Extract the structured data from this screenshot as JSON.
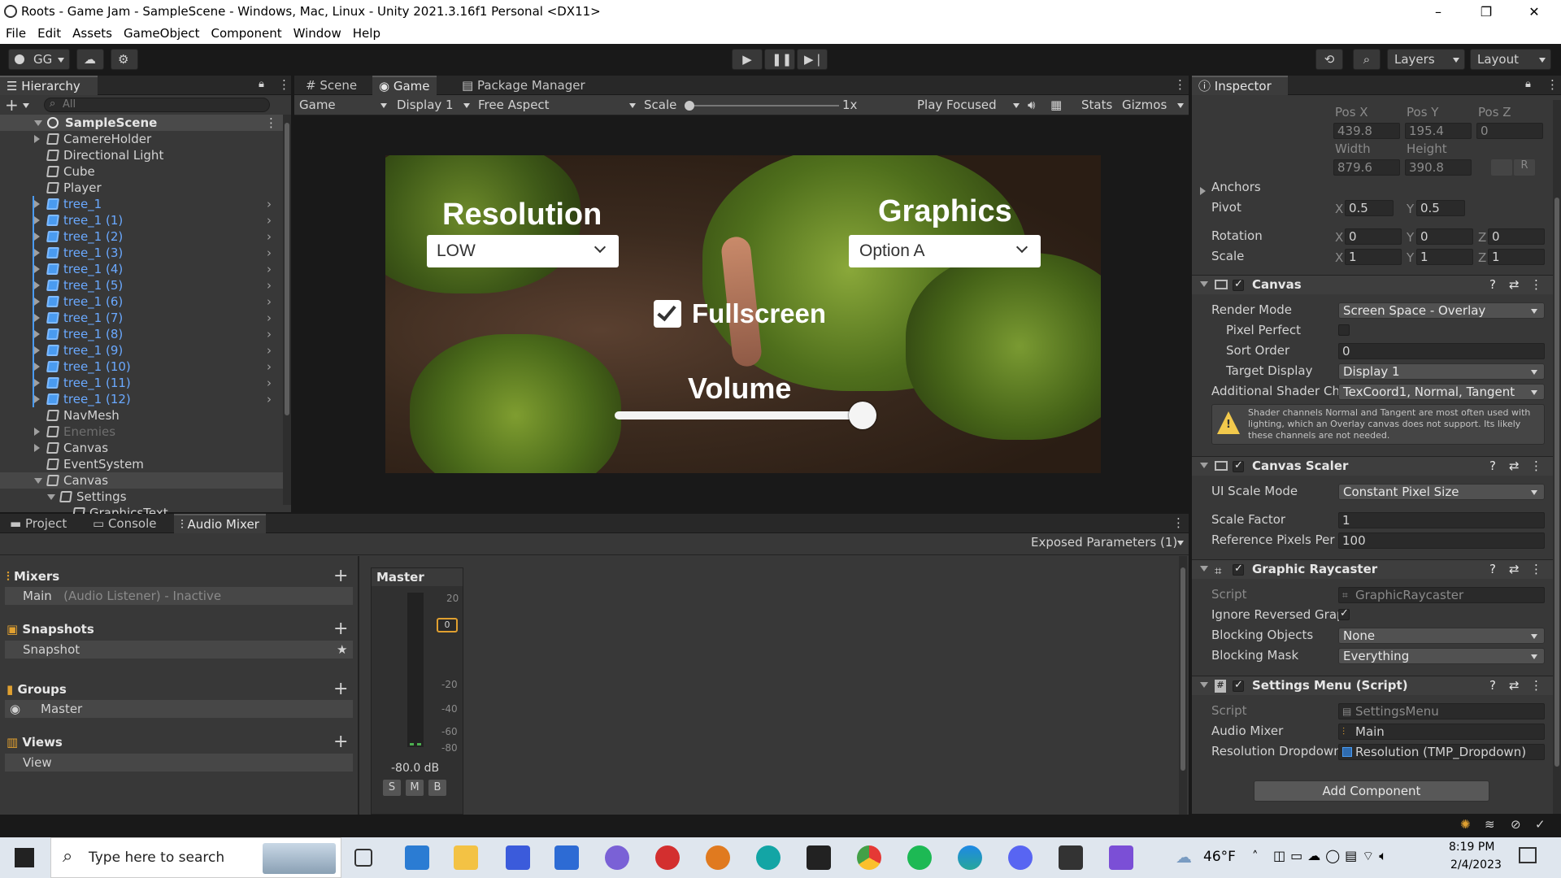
{
  "window": {
    "title": "Roots - Game Jam - SampleScene - Windows, Mac, Linux - Unity 2021.3.16f1 Personal <DX11>"
  },
  "menu": [
    "File",
    "Edit",
    "Assets",
    "GameObject",
    "Component",
    "Window",
    "Help"
  ],
  "toolbar": {
    "account": "GG",
    "layers": "Layers",
    "layout": "Layout"
  },
  "hierarchy": {
    "tab": "Hierarchy",
    "search_placeholder": "All",
    "scene": "SampleScene",
    "items": [
      "CamereHolder",
      "Directional Light",
      "Cube",
      "Player",
      "tree_1",
      "tree_1 (1)",
      "tree_1 (2)",
      "tree_1 (3)",
      "tree_1 (4)",
      "tree_1 (5)",
      "tree_1 (6)",
      "tree_1 (7)",
      "tree_1 (8)",
      "tree_1 (9)",
      "tree_1 (10)",
      "tree_1 (11)",
      "tree_1 (12)",
      "NavMesh",
      "Enemies",
      "Canvas",
      "EventSystem",
      "Canvas",
      "Settings",
      "GraphicsText"
    ]
  },
  "center_tabs": {
    "scene": "Scene",
    "game": "Game",
    "package": "Package Manager"
  },
  "game_toolbar": {
    "mode": "Game",
    "display": "Display 1",
    "aspect": "Free Aspect",
    "scale_label": "Scale",
    "scale_value": "1x",
    "play_focused": "Play Focused",
    "stats": "Stats",
    "gizmos": "Gizmos"
  },
  "game_ui": {
    "resolution_title": "Resolution",
    "resolution_value": "LOW",
    "graphics_title": "Graphics",
    "graphics_value": "Option A",
    "fullscreen": "Fullscreen",
    "volume": "Volume",
    "volume_level": 1.0
  },
  "inspector": {
    "tab": "Inspector",
    "pos_x_label": "Pos X",
    "pos_y_label": "Pos Y",
    "pos_z_label": "Pos Z",
    "pos_x": "439.8",
    "pos_y": "195.4",
    "pos_z": "0",
    "width_label": "Width",
    "height_label": "Height",
    "width": "879.6",
    "height": "390.8",
    "anchors": "Anchors",
    "pivot": "Pivot",
    "pivot_x": "0.5",
    "pivot_y": "0.5",
    "rotation": "Rotation",
    "rot_x": "0",
    "rot_y": "0",
    "rot_z": "0",
    "scale": "Scale",
    "scale_x": "1",
    "scale_y": "1",
    "scale_z": "1",
    "canvas": {
      "title": "Canvas",
      "render_mode_label": "Render Mode",
      "render_mode": "Screen Space - Overlay",
      "pixel_perfect": "Pixel Perfect",
      "sort_order_label": "Sort Order",
      "sort_order": "0",
      "target_display_label": "Target Display",
      "target_display": "Display 1",
      "shader_label": "Additional Shader Ch",
      "shader": "TexCoord1, Normal, Tangent",
      "warning": "Shader channels Normal and Tangent are most often used with lighting, which an Overlay canvas does not support. Its likely these channels are not needed."
    },
    "scaler": {
      "title": "Canvas Scaler",
      "ui_scale_label": "UI Scale Mode",
      "ui_scale": "Constant Pixel Size",
      "scale_factor_label": "Scale Factor",
      "scale_factor": "1",
      "ref_pixels_label": "Reference Pixels Per",
      "ref_pixels": "100"
    },
    "raycaster": {
      "title": "Graphic Raycaster",
      "script_label": "Script",
      "script": "GraphicRaycaster",
      "ignore_label": "Ignore Reversed Grap",
      "blocking_label": "Blocking Objects",
      "blocking": "None",
      "mask_label": "Blocking Mask",
      "mask": "Everything"
    },
    "settings_menu": {
      "title": "Settings Menu (Script)",
      "script_label": "Script",
      "script": "SettingsMenu",
      "mixer_label": "Audio Mixer",
      "mixer": "Main",
      "res_label": "Resolution Dropdown",
      "res": "Resolution (TMP_Dropdown)"
    },
    "add_component": "Add Component"
  },
  "bottom_tabs": {
    "project": "Project",
    "console": "Console",
    "audio_mixer": "Audio Mixer"
  },
  "audio_mixer": {
    "exposed": "Exposed Parameters (1)",
    "mixers": "Mixers",
    "mixer_item": "Main",
    "mixer_item_note": "(Audio Listener) - Inactive",
    "snapshots": "Snapshots",
    "snapshot_item": "Snapshot",
    "groups": "Groups",
    "group_item": "Master",
    "views": "Views",
    "view_item": "View",
    "strip": {
      "name": "Master",
      "db": "-80.0 dB",
      "s": "S",
      "m": "M",
      "b": "B",
      "level": "0",
      "scale": [
        "20",
        "0",
        "-20",
        "-40",
        "-60",
        "-80"
      ]
    }
  },
  "taskbar": {
    "search_placeholder": "Type here to search",
    "temp": "46°F",
    "time": "8:19 PM",
    "date": "2/4/2023"
  }
}
